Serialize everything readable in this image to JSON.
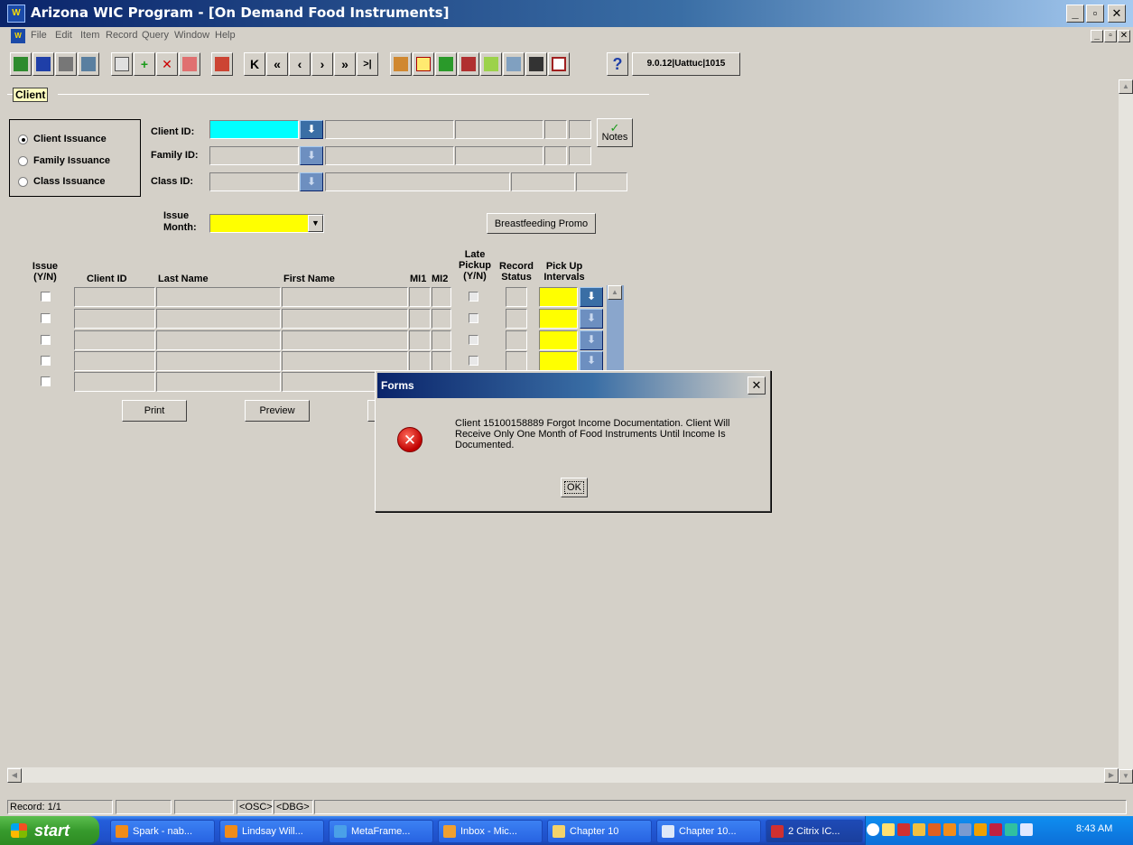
{
  "window": {
    "title": "Arizona WIC Program - [On Demand Food Instruments]",
    "app_icon": "app-icon",
    "min": "_",
    "max": "▫",
    "close": "✕"
  },
  "menu": [
    "File",
    "Edit",
    "Item",
    "Record",
    "Query",
    "Window",
    "Help"
  ],
  "toolbar": {
    "version": "9.0.12|Uattuc|1015",
    "nav_first": "K",
    "nav_prev_set": "«",
    "nav_prev": "‹",
    "nav_next": "›",
    "nav_next_set": "»",
    "nav_last": ">|",
    "help": "?"
  },
  "section": {
    "title": "Client"
  },
  "issuance": {
    "options": [
      "Client Issuance",
      "Family Issuance",
      "Class Issuance"
    ],
    "selected": "Client Issuance"
  },
  "fields": {
    "client_id_label": "Client ID:",
    "family_id_label": "Family ID:",
    "class_id_label": "Class ID:",
    "issue_month_label_1": "Issue",
    "issue_month_label_2": "Month:",
    "notes_label": "Notes",
    "breastfeeding_label": "Breastfeeding Promo"
  },
  "grid": {
    "headers": {
      "issue_1": "Issue",
      "issue_2": "(Y/N)",
      "client_id": "Client ID",
      "last_name": "Last Name",
      "first_name": "First Name",
      "mi1": "MI1",
      "mi2": "MI2",
      "late_1": "Late",
      "late_2": "Pickup",
      "late_3": "(Y/N)",
      "record_1": "Record",
      "record_2": "Status",
      "pickup_1": "Pick Up",
      "pickup_2": "Intervals"
    },
    "row_count": 5
  },
  "buttons": {
    "print": "Print",
    "preview": "Preview"
  },
  "dialog": {
    "title": "Forms",
    "message": "Client 15100158889 Forgot Income Documentation. Client Will Receive Only One Month of Food Instruments Until Income Is Documented.",
    "ok": "OK",
    "icon": "error-icon"
  },
  "status": {
    "record": "Record: 1/1",
    "osc": "<OSC>",
    "dbg": "<DBG>"
  },
  "taskbar": {
    "start": "start",
    "tasks": [
      "Spark - nab...",
      "Lindsay Will...",
      "MetaFrame...",
      "Inbox - Mic...",
      "Chapter 10",
      "Chapter 10...",
      "2 Citrix IC..."
    ],
    "clock": "8:43 AM"
  },
  "colors": {
    "title_start": "#0a246a",
    "title_end": "#a6caf0",
    "client_field": "#00ffff",
    "required_field": "#ffff00",
    "lov_button": "#3a6ea5",
    "taskbar": "#245edb",
    "start": "#379b2d"
  }
}
